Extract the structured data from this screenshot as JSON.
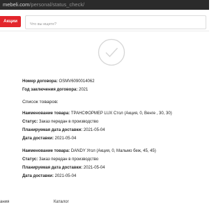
{
  "browser": {
    "url_domain": "mebeli.com",
    "url_path": "/personal/status_check/"
  },
  "header": {
    "actions_button": "Акции",
    "search_placeholder": "Что вы ищете?"
  },
  "contract": {
    "number_label": "Номер договора:",
    "number_value": "OSMV6090014062",
    "year_label": "Год заключения договора:",
    "year_value": "2021"
  },
  "goods_title": "Список товаров:",
  "items": [
    {
      "name_label": "Наименование товара:",
      "name_value": "ТРАНСФОРМЕР LUX Стол (Акция, 0, Венге , 30, 30)",
      "status_label": "Статус:",
      "status_value": "Заказ передан в производство",
      "planned_label": "Планируемая дата доставки:",
      "planned_value": "2021-05-04",
      "delivery_label": "Дата доставки:",
      "delivery_value": "2021-05-04"
    },
    {
      "name_label": "Наименование товара:",
      "name_value": "DANDY Угол (Акция, 0, Мальмо беж, 45, 45)",
      "status_label": "Статус:",
      "status_value": "Заказ передан в производство",
      "planned_label": "Планируемая дата доставки:",
      "planned_value": "2021-05-04",
      "delivery_label": "Дата доставки:",
      "delivery_value": "2021-05-04"
    }
  ],
  "footer": {
    "left_fragment": "ания",
    "catalog": "Каталог"
  },
  "colors": {
    "accent": "#e3262c",
    "check": "#d5d5d5"
  }
}
